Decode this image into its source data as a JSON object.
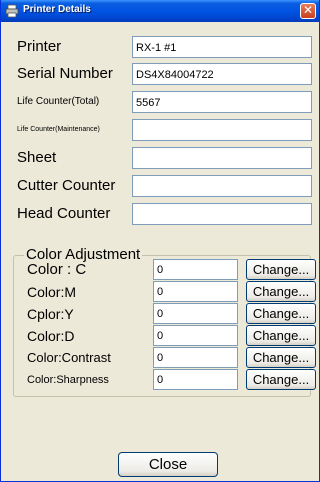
{
  "window": {
    "title": "Printer Details",
    "close_glyph": "✕",
    "title_icon": "printer-icon"
  },
  "fields": [
    {
      "label": "Printer",
      "value": "RX-1 #1"
    },
    {
      "label": "Serial Number",
      "value": "DS4X84004722"
    },
    {
      "label": "Life Counter(Total)",
      "value": "5567"
    },
    {
      "label": "Life Counter(Maintenance)",
      "value": ""
    },
    {
      "label": "Sheet",
      "value": ""
    },
    {
      "label": "Cutter Counter",
      "value": ""
    },
    {
      "label": "Head Counter",
      "value": ""
    }
  ],
  "color_adjustment": {
    "title": "Color Adjustment",
    "rows": [
      {
        "label": "Color : C",
        "value": "0",
        "button": "Change..."
      },
      {
        "label": "Color:M",
        "value": "0",
        "button": "Change..."
      },
      {
        "label": "Cplor:Y",
        "value": "0",
        "button": "Change..."
      },
      {
        "label": "Color:D",
        "value": "0",
        "button": "Change..."
      },
      {
        "label": "Color:Contrast",
        "value": "0",
        "button": "Change..."
      },
      {
        "label": "Color:Sharpness",
        "value": "0",
        "button": "Change..."
      }
    ]
  },
  "footer": {
    "close_label": "Close"
  },
  "colors": {
    "title_bar": "#0054e3",
    "window_bg": "#ece9d8",
    "close_button": "#c8401f"
  }
}
